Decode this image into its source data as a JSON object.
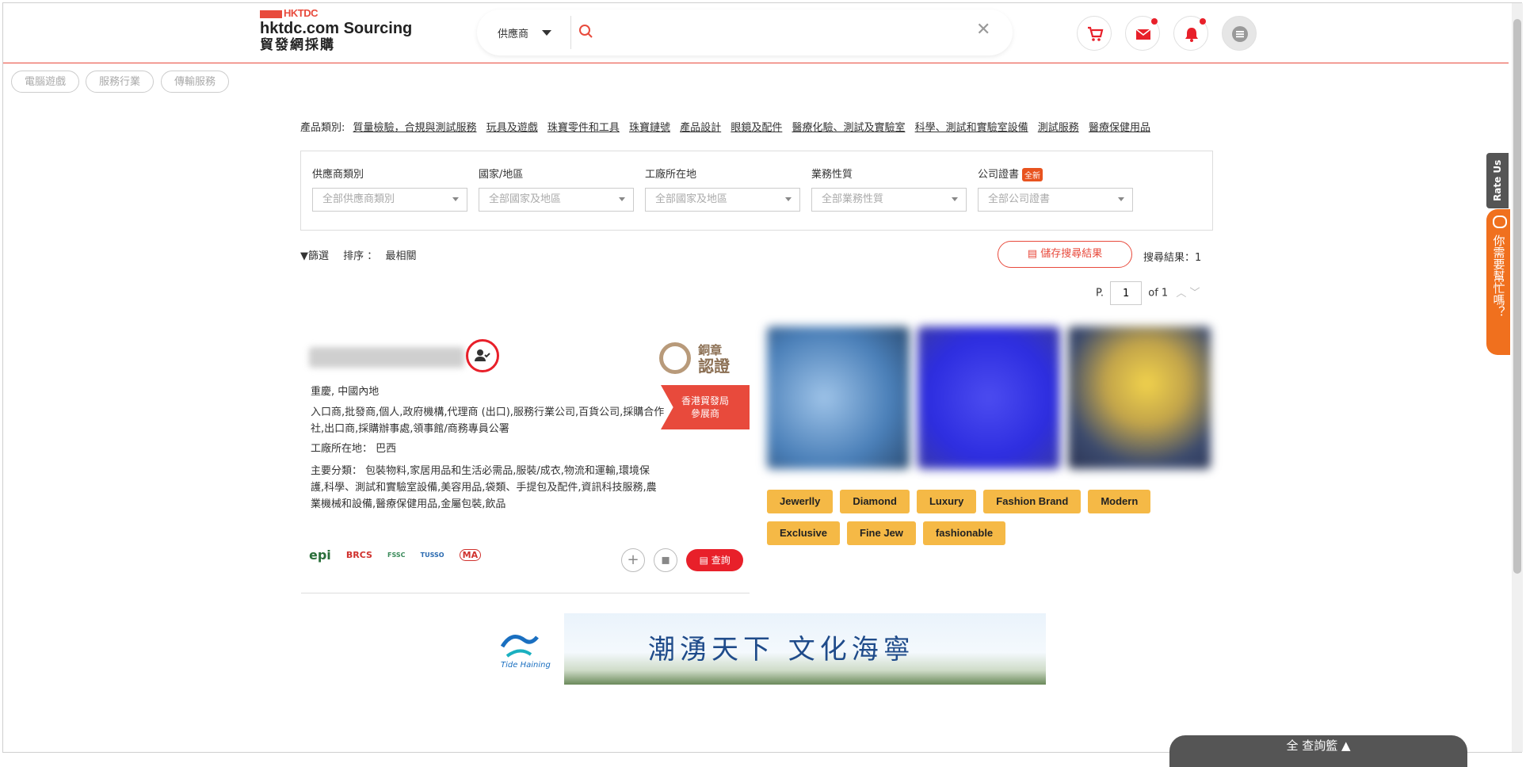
{
  "header": {
    "brand_small": "HKTDC",
    "brand_title": "hktdc.com Sourcing",
    "brand_subtitle": "貿發網採購",
    "search_category": "供應商",
    "search_placeholder": "",
    "clear_symbol": "✕"
  },
  "pills": [
    "電腦遊戲",
    "服務行業",
    "傳輸服務"
  ],
  "categories": {
    "label": "產品類別:",
    "items": [
      "質量檢驗，合規與測試服務",
      "玩具及遊戲",
      "珠寶零件和工具",
      "珠寶鏈號",
      "產品設計",
      "眼鏡及配件",
      "醫療化驗、測試及實驗室",
      "科學、測試和實驗室設備",
      "測試服務",
      "醫療保健用品"
    ]
  },
  "filters": [
    {
      "label": "供應商類別",
      "value": "全部供應商類別",
      "is_new": false
    },
    {
      "label": "國家/地區",
      "value": "全部國家及地區",
      "is_new": false
    },
    {
      "label": "工廠所在地",
      "value": "全部國家及地區",
      "is_new": false
    },
    {
      "label": "業務性質",
      "value": "全部業務性質",
      "is_new": false
    },
    {
      "label": "公司證書",
      "value": "全部公司證書",
      "is_new": true,
      "badge": "全新"
    }
  ],
  "toolbar": {
    "filter_label": "篩選",
    "sort_label": "排序 ：",
    "sort_value": "最相關",
    "save_label": "儲存搜尋結果",
    "results_label": "搜尋結果：1"
  },
  "pager": {
    "prefix": "P.",
    "page": "1",
    "of": "of 1"
  },
  "supplier": {
    "bronze_line1": "銅章",
    "bronze_line2": "認證",
    "ribbon_line1": "香港貿發局",
    "ribbon_line2": "參展商",
    "location": "重慶, 中國內地",
    "business_types": "入口商,批發商,個人,政府機構,代理商 (出口),服務行業公司,百貨公司,採購合作社,出口商,採購辦事處,領事館/商務專員公署",
    "factory": "工廠所在地： 巴西",
    "main_categories": "主要分類： 包裝物料,家居用品和生活必需品,服裝/成衣,物流和運輸,環境保護,科學、測試和實驗室設備,美容用品,袋類、手提包及配件,資訊科技服務,農業機械和設備,醫療保健用品,金屬包裝,飲品",
    "cert_logos": [
      "epi",
      "BRCS",
      "FSSC",
      "TUSSO",
      "MA"
    ],
    "inquire_label": "查詢"
  },
  "tags": [
    "Jewerlly",
    "Diamond",
    "Luxury",
    "Fashion Brand",
    "Modern",
    "Exclusive",
    "Fine Jew",
    "fashionable"
  ],
  "banner": {
    "slogan": "潮湧天下 文化海寧",
    "logo_text": "Tide Haining"
  },
  "side": {
    "rate_us": "Rate Us",
    "help": "你需要幫忙嗎？"
  },
  "bottom_tab": "全 查詢籃 ▲",
  "colors": {
    "accent": "#e84a3c",
    "tag": "#f5b946",
    "help": "#f0701e"
  }
}
